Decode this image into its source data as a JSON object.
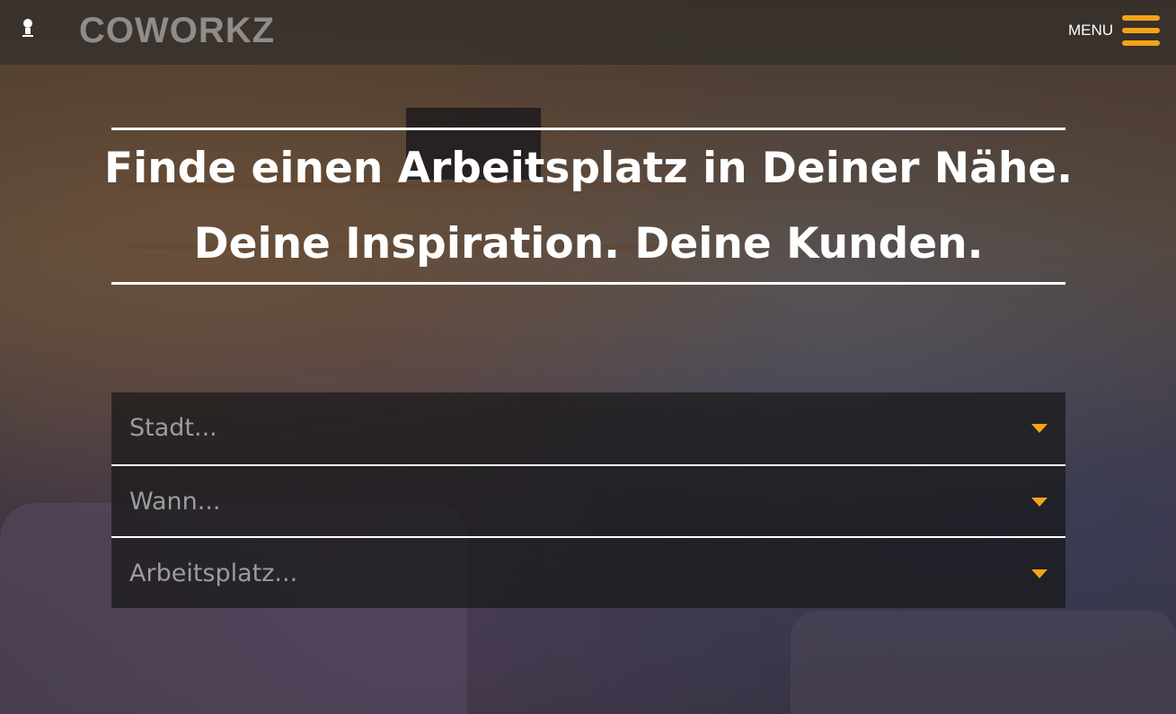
{
  "header": {
    "logo_text": "COWORKZ",
    "menu_label": "MENU",
    "user_icon": "person-icon",
    "menu_icon": "hamburger-icon",
    "accent_color": "#f5a31a"
  },
  "hero": {
    "line1": "Finde einen Arbeitsplatz in Deiner Nähe.",
    "line2": "Deine Inspiration. Deine Kunden."
  },
  "search": {
    "city_placeholder": "Stadt...",
    "date_placeholder": "Wann...",
    "workspace_placeholder": "Arbeitsplatz...",
    "dropdown_icon": "caret-down-icon"
  }
}
